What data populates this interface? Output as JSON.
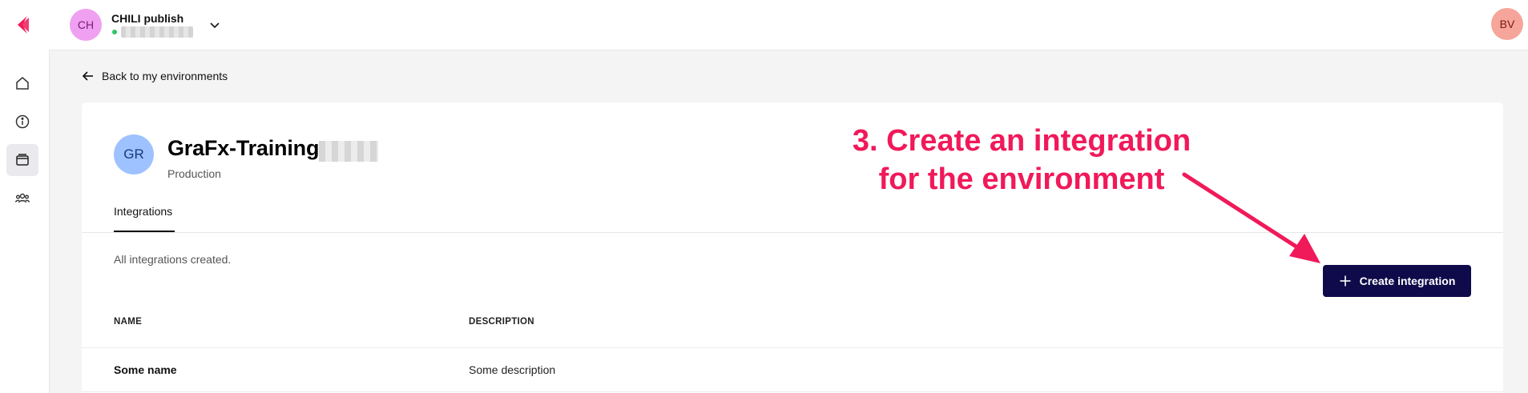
{
  "topbar": {
    "env_avatar": "CH",
    "env_name": "CHILI publish",
    "user_avatar": "BV"
  },
  "nav": {
    "back_label": "Back to my environments"
  },
  "environment": {
    "avatar": "GR",
    "title": "GraFx-Training",
    "type": "Production"
  },
  "tabs": [
    {
      "label": "Integrations",
      "active": true
    }
  ],
  "integrations": {
    "status_text": "All integrations created.",
    "create_label": "Create integration",
    "columns": [
      "NAME",
      "DESCRIPTION"
    ],
    "rows": [
      {
        "name": "Some name",
        "description": "Some description"
      }
    ]
  },
  "annotation": {
    "line1": "3. Create an integration",
    "line2": "for the environment"
  },
  "colors": {
    "accent": "#f0195a",
    "button": "#0f0a4a",
    "env_avatar_bg": "#f0a0f0",
    "user_avatar_bg": "#f6a59a",
    "gr_avatar_bg": "#9ec2ff",
    "status_online": "#2fc46b"
  },
  "icons": {
    "rail": [
      "home-icon",
      "info-icon",
      "environments-icon",
      "users-icon"
    ],
    "misc": [
      "chili-logo",
      "chevron-down-icon",
      "arrow-left-icon",
      "plus-icon",
      "annotation-arrow"
    ]
  }
}
